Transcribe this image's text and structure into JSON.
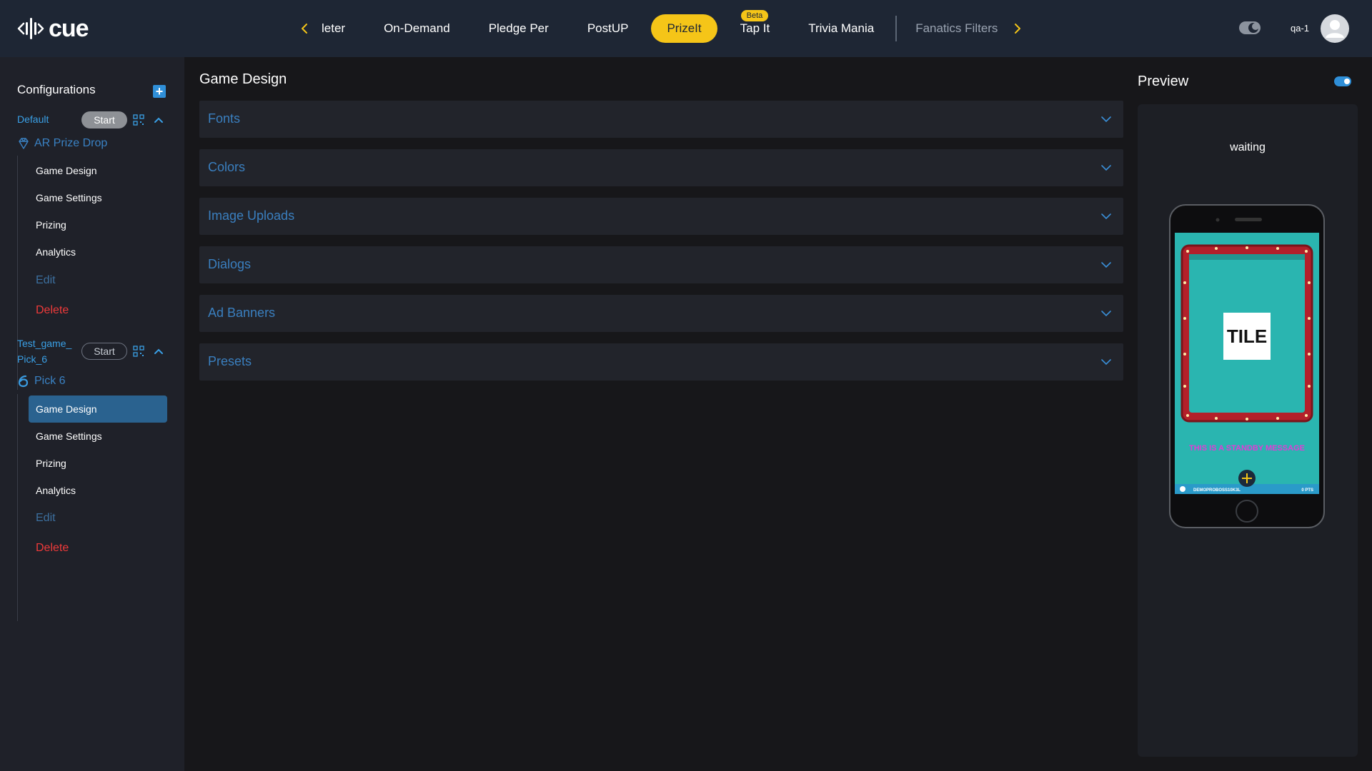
{
  "brand": {
    "logo_text": "cue"
  },
  "nav": {
    "tabs": [
      {
        "label": "leter",
        "state": "normal"
      },
      {
        "label": "On-Demand",
        "state": "normal"
      },
      {
        "label": "Pledge Per",
        "state": "normal"
      },
      {
        "label": "PostUP",
        "state": "normal"
      },
      {
        "label": "PrizeIt",
        "state": "active"
      },
      {
        "label": "Tap It",
        "state": "normal",
        "badge": "Beta"
      },
      {
        "label": "Trivia Mania",
        "state": "normal"
      },
      {
        "label": "Fanatics Filters",
        "state": "dim"
      }
    ]
  },
  "user": {
    "name": "qa-1"
  },
  "sidebar": {
    "header": "Configurations",
    "configs": [
      {
        "name": "Default",
        "start_label": "Start",
        "game_type": "AR Prize Drop",
        "items": [
          "Game Design",
          "Game Settings",
          "Prizing",
          "Analytics"
        ],
        "edit_label": "Edit",
        "delete_label": "Delete"
      },
      {
        "name_line1": "Test_game_",
        "name_line2": "Pick_6",
        "start_label": "Start",
        "game_type": "Pick 6",
        "items": [
          "Game Design",
          "Game Settings",
          "Prizing",
          "Analytics"
        ],
        "edit_label": "Edit",
        "delete_label": "Delete"
      }
    ]
  },
  "main": {
    "title": "Game Design",
    "sections": [
      "Fonts",
      "Colors",
      "Image Uploads",
      "Dialogs",
      "Ad Banners",
      "Presets"
    ]
  },
  "preview": {
    "title": "Preview",
    "status": "waiting",
    "tile_text": "TILE",
    "standby_message": "THIS IS A STANDBY MESSAGE",
    "footer_name": "DEMOPROBOSS10K3L",
    "footer_pts": "0 PTS"
  },
  "colors": {
    "accent": "#2f8fd8",
    "active_tab": "#f5c518",
    "delete": "#ee3a3a",
    "screen_teal": "#2ab5b0",
    "frame_red": "#b3202a"
  },
  "icons": {
    "nav_prev": "chevron-left-icon",
    "nav_next": "chevron-right-icon",
    "theme": "theme-toggle-icon",
    "add": "plus-square-icon",
    "qr": "qr-code-icon",
    "collapse": "chevron-up-icon",
    "prize_drop": "diamond-pin-icon",
    "pick6": "pick-six-icon",
    "expand": "chevron-down-icon"
  }
}
